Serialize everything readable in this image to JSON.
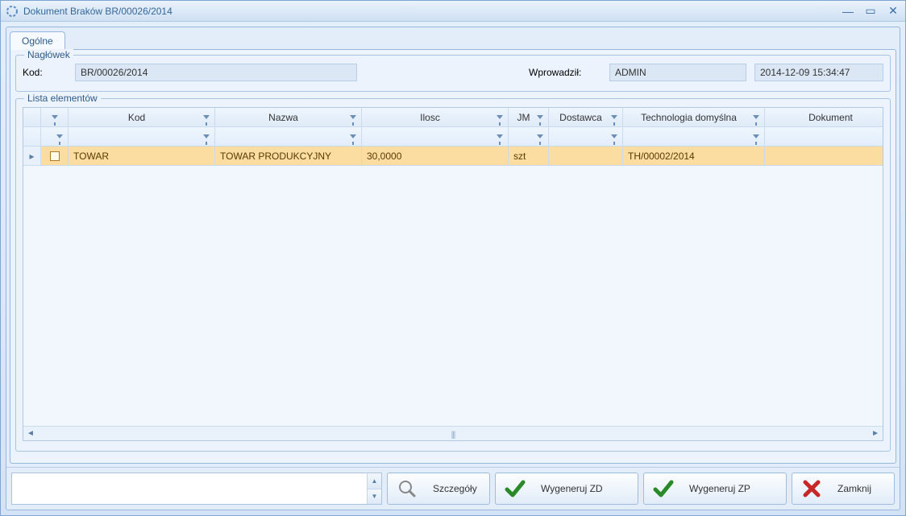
{
  "window": {
    "title": "Dokument Braków BR/00026/2014"
  },
  "tabs": {
    "general": "Ogólne"
  },
  "header": {
    "legend": "Nagłówek",
    "kod_label": "Kod:",
    "kod_value": "BR/00026/2014",
    "wprowadzil_label": "Wprowadził:",
    "wprowadzil_value": "ADMIN",
    "date_value": "2014-12-09 15:34:47"
  },
  "list": {
    "legend": "Lista elementów",
    "columns": {
      "kod": "Kod",
      "nazwa": "Nazwa",
      "ilosc": "Ilosc",
      "jm": "JM",
      "dostawca": "Dostawca",
      "technologia": "Technologia domyślna",
      "dokument": "Dokument"
    },
    "rows": [
      {
        "kod": "TOWAR",
        "nazwa": "TOWAR PRODUKCYJNY",
        "ilosc": "30,0000",
        "jm": "szt",
        "dostawca": "",
        "technologia": "TH/00002/2014",
        "dokument": ""
      }
    ]
  },
  "buttons": {
    "details": "Szczegóły",
    "gen_zd": "Wygeneruj ZD",
    "gen_zp": "Wygeneruj ZP",
    "close": "Zamknij"
  }
}
